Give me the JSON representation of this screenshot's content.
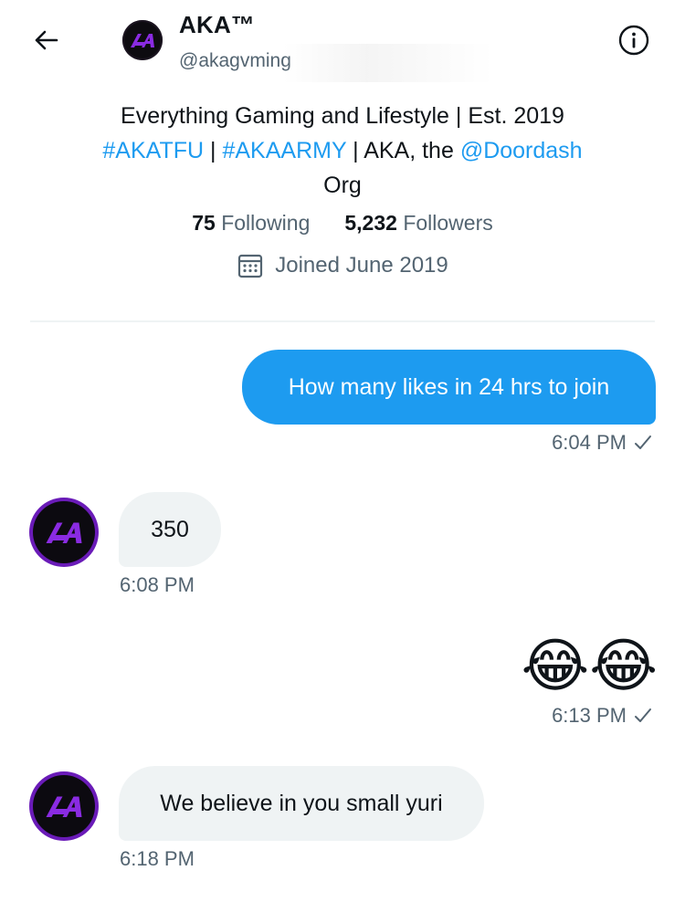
{
  "header": {
    "name": "AKA™",
    "handle": "@akagvming",
    "avatar_text": "AKA"
  },
  "profile": {
    "bio_line1": "Everything Gaming and Lifestyle | Est. 2019",
    "hashtag1": "#AKATFU",
    "sep1": " | ",
    "hashtag2": "#AKAARMY",
    "bio_mid": " | AKA, the ",
    "mention": "@Doordash",
    "bio_line3": "Org",
    "following_count": "75",
    "following_label": "Following",
    "followers_count": "5,232",
    "followers_label": "Followers",
    "joined": "Joined June 2019"
  },
  "messages": [
    {
      "direction": "outgoing",
      "text": "How many likes in 24 hrs to join",
      "time": "6:04 PM"
    },
    {
      "direction": "incoming",
      "text": "350",
      "time": "6:08 PM"
    },
    {
      "direction": "outgoing",
      "text": "😂😂",
      "time": "6:13 PM"
    },
    {
      "direction": "incoming",
      "text": "We believe in you small yuri",
      "time": "6:18 PM"
    }
  ],
  "colors": {
    "accent": "#1d9bf0",
    "avatar_ring": "#6a1bb8",
    "avatar_logo": "#8a2be2",
    "muted_text": "#536471"
  },
  "icons": {
    "back": "arrow-left-icon",
    "info": "info-icon",
    "calendar": "calendar-icon",
    "read_receipt": "check-icon"
  }
}
